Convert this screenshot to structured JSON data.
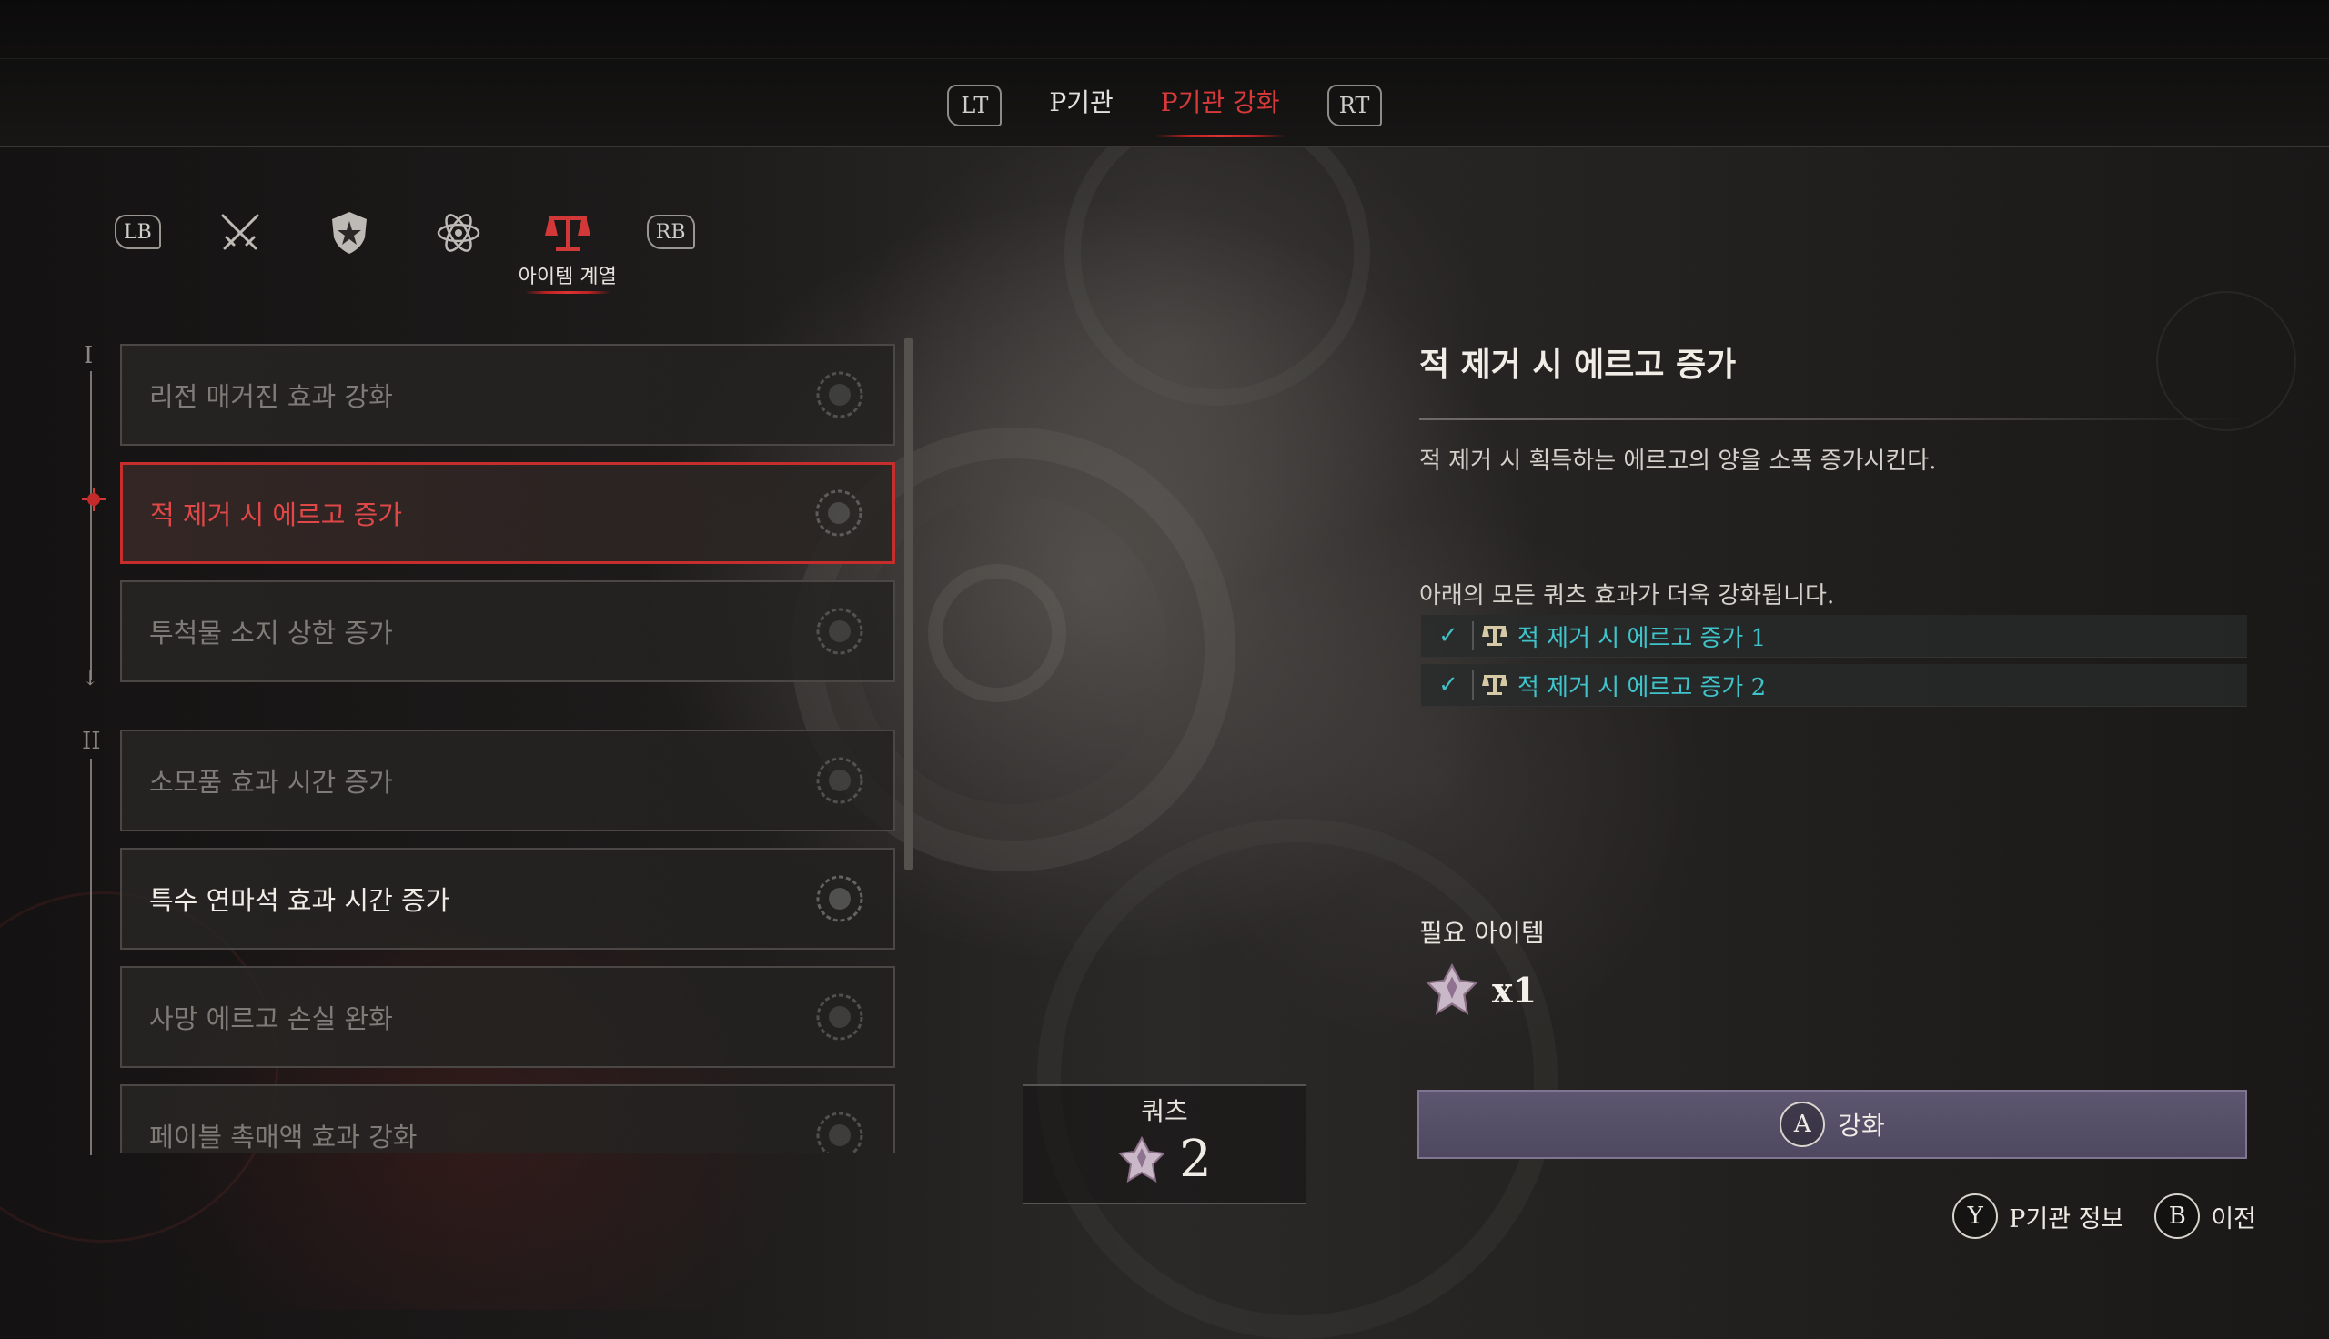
{
  "topbar": {
    "left_button": "LT",
    "right_button": "RT",
    "tabs": [
      {
        "label": "P기관",
        "active": false
      },
      {
        "label": "P기관 강화",
        "active": true
      }
    ]
  },
  "categories": {
    "left_button": "LB",
    "right_button": "RB",
    "items": [
      {
        "icon": "crossed-swords-icon",
        "label": ""
      },
      {
        "icon": "shield-emblem-icon",
        "label": ""
      },
      {
        "icon": "atom-icon",
        "label": ""
      },
      {
        "icon": "scales-icon",
        "label": "아이템 계열",
        "active": true
      }
    ]
  },
  "tiers": [
    "I",
    "II"
  ],
  "list": {
    "items": [
      {
        "label": "리전 매거진 효과 강화",
        "state": "dim"
      },
      {
        "label": "적 제거 시 에르고 증가",
        "state": "selected"
      },
      {
        "label": "투척물 소지 상한 증가",
        "state": "dim"
      },
      {
        "label": "소모품 효과 시간 증가",
        "state": "dim"
      },
      {
        "label": "특수 연마석 효과 시간 증가",
        "state": "bright"
      },
      {
        "label": "사망 에르고 손실 완화",
        "state": "dim"
      },
      {
        "label": "페이블 촉매액 효과 강화",
        "state": "dim"
      }
    ]
  },
  "quartz": {
    "title": "쿼츠",
    "count": "2"
  },
  "detail": {
    "title": "적 제거 시 에르고 증가",
    "description": "적 제거 시 획득하는 에르고의 양을 소폭 증가시킨다.",
    "enhance_note": "아래의 모든 쿼츠 효과가 더욱 강화됩니다.",
    "effects": [
      {
        "label": "적 제거 시 에르고 증가 1",
        "checked": true
      },
      {
        "label": "적 제거 시 에르고 증가 2",
        "checked": true
      }
    ],
    "required_title": "필요 아이템",
    "required_qty": "x1",
    "upgrade_key": "A",
    "upgrade_label": "강화"
  },
  "footer": {
    "info_key": "Y",
    "info_label": "P기관 정보",
    "back_key": "B",
    "back_label": "이전"
  },
  "colors": {
    "accent_red": "#d83a3a",
    "effect_cyan": "#3fc4cb",
    "button_purple": "#5d5670"
  }
}
